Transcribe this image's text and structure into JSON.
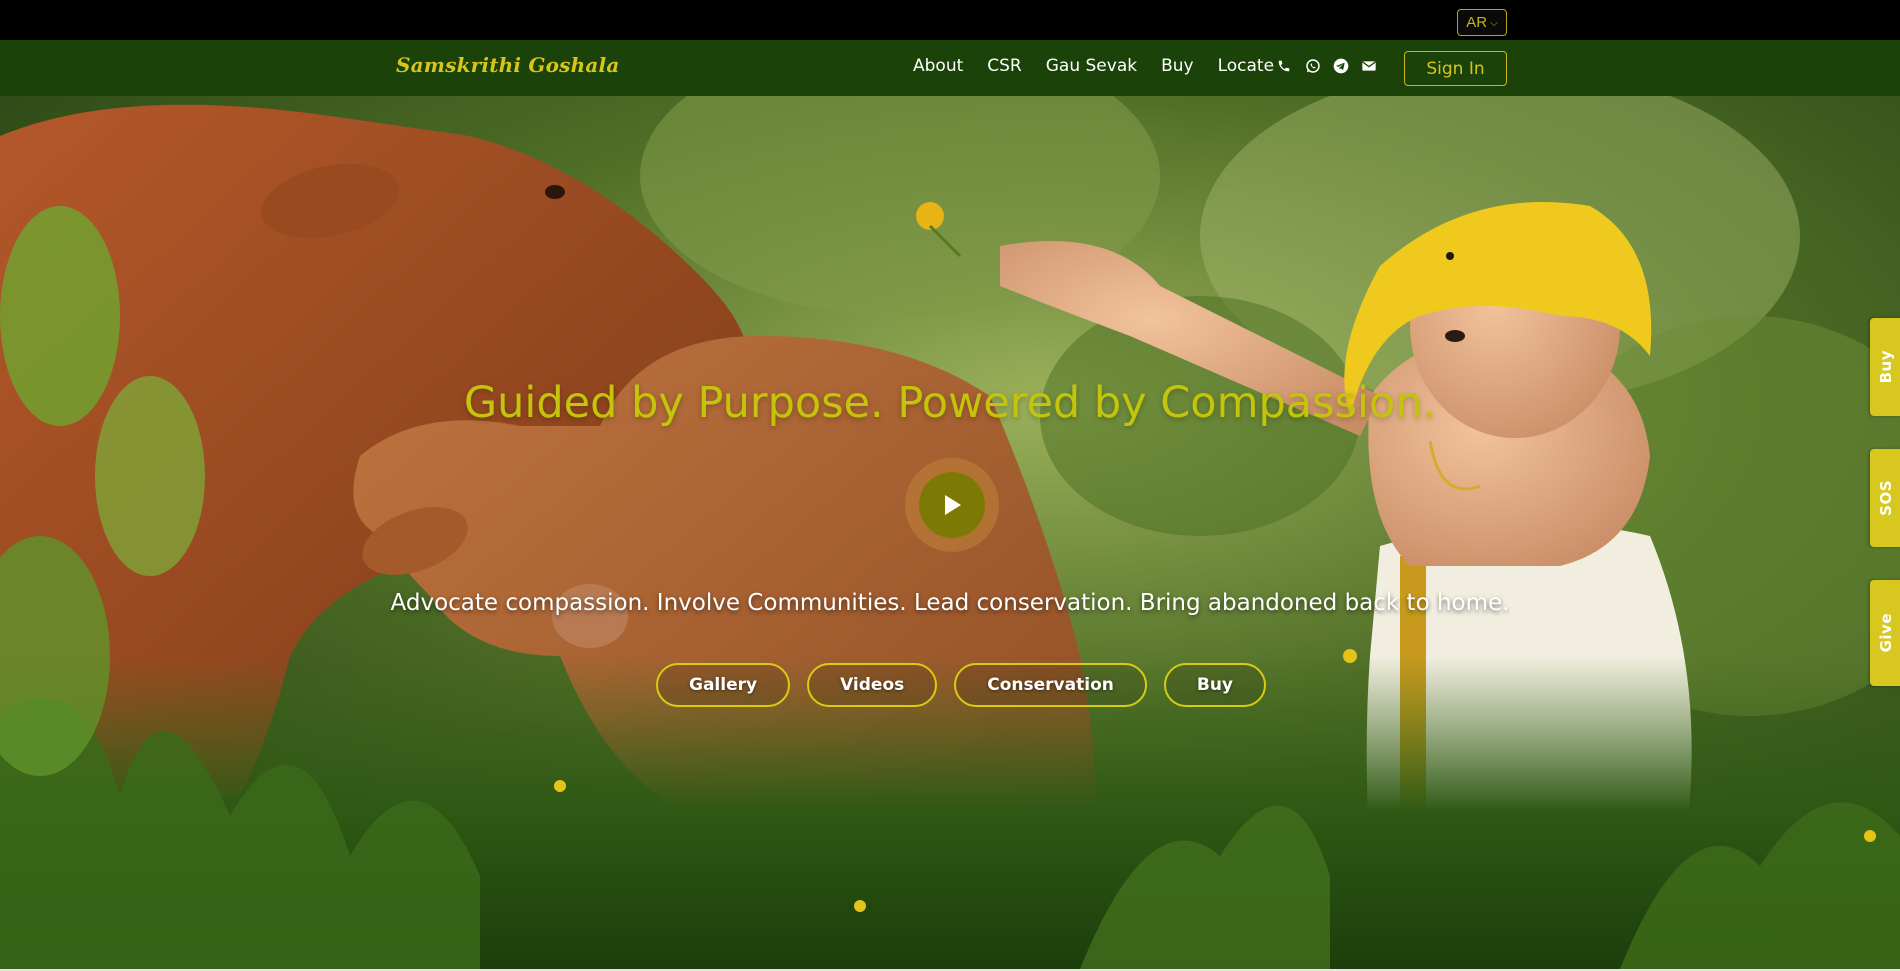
{
  "topbar": {
    "language": "AR"
  },
  "nav": {
    "brand": "Samskrithi Goshala",
    "links": [
      "About",
      "CSR",
      "Gau Sevak",
      "Buy",
      "Locate"
    ],
    "contact_icons": [
      "phone-icon",
      "whatsapp-icon",
      "telegram-icon",
      "mail-icon"
    ],
    "signin": "Sign In"
  },
  "hero": {
    "title": "Guided by Purpose. Powered by Compassion.",
    "subtitle": "Advocate compassion. Involve Communities. Lead conservation. Bring abandoned back to home.",
    "buttons": [
      "Gallery",
      "Videos",
      "Conservation",
      "Buy"
    ],
    "play_icon": "play-icon"
  },
  "side_tabs": [
    "Buy",
    "SOS",
    "Give"
  ],
  "colors": {
    "nav_bg": "#1b4208",
    "accent": "#d7c51c",
    "title": "#c4c40a"
  }
}
